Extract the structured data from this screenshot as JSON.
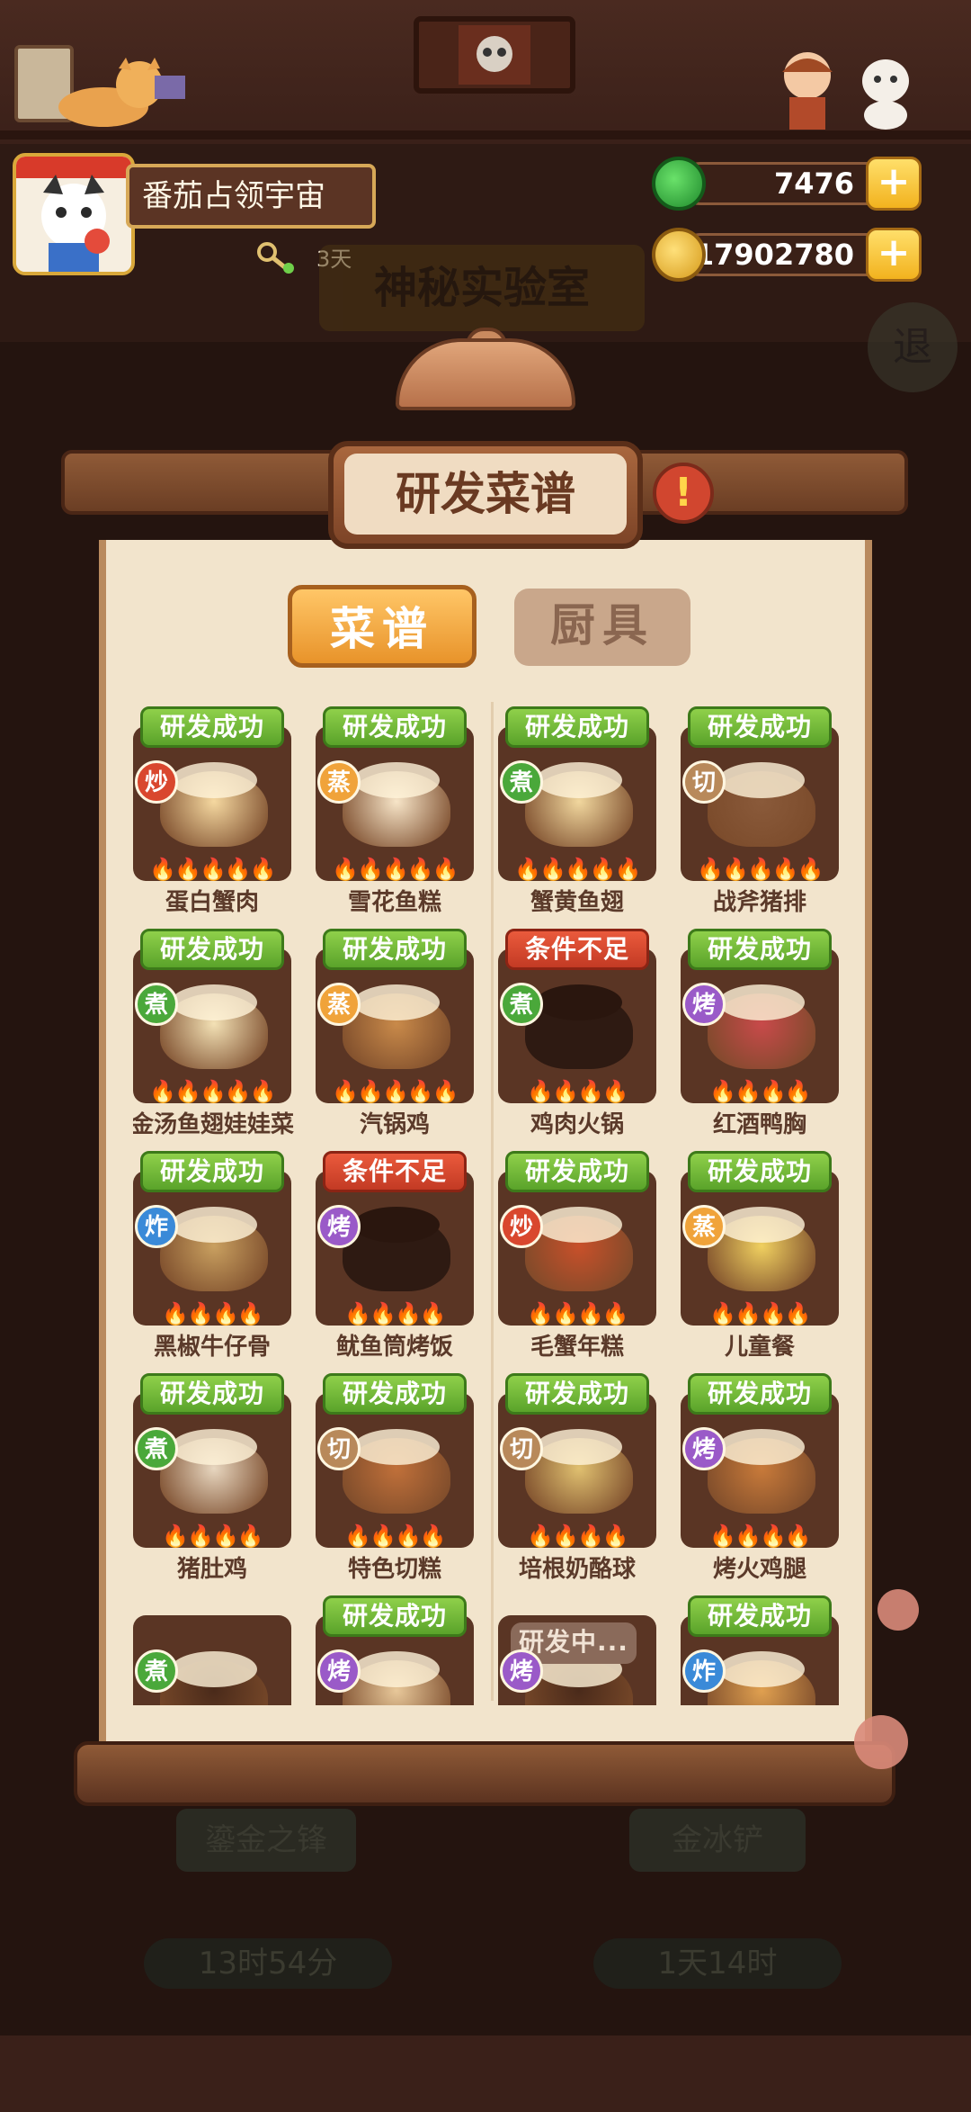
{
  "player": {
    "name": "番茄占领宇宙",
    "days": "3天"
  },
  "currency": {
    "jade": "7476",
    "coins": "17902780",
    "plus_label": "+"
  },
  "background": {
    "room_title": "神秘实验室",
    "exit_label": "退",
    "tool1": "鎏金之锋",
    "tool2": "金冰铲",
    "timer1": "13时54分",
    "timer2": "1天14时"
  },
  "panel": {
    "title": "研发菜谱",
    "alert": "!"
  },
  "tabs": {
    "recipes": "菜谱",
    "tools": "厨具"
  },
  "colors": {
    "success": "#6fbf35",
    "fail": "#d9472e",
    "accent": "#f0a33a"
  },
  "recipes": [
    {
      "status": "研发成功",
      "method": "炒",
      "name": "蛋白蟹肉",
      "flames": "🔥🔥🔥🔥🔥"
    },
    {
      "status": "研发成功",
      "method": "蒸",
      "name": "雪花鱼糕",
      "flames": "🔥🔥🔥🔥🔥"
    },
    {
      "status": "研发成功",
      "method": "煮",
      "name": "蟹黄鱼翅",
      "flames": "🔥🔥🔥🔥🔥"
    },
    {
      "status": "研发成功",
      "method": "切",
      "name": "战斧猪排",
      "flames": "🔥🔥🔥🔥🔥"
    },
    {
      "status": "研发成功",
      "method": "煮",
      "name": "金汤鱼翅娃娃菜",
      "flames": "🔥🔥🔥🔥🔥"
    },
    {
      "status": "研发成功",
      "method": "蒸",
      "name": "汽锅鸡",
      "flames": "🔥🔥🔥🔥🔥"
    },
    {
      "status": "条件不足",
      "method": "煮",
      "name": "鸡肉火锅",
      "flames": "🔥🔥🔥🔥"
    },
    {
      "status": "研发成功",
      "method": "烤",
      "name": "红酒鸭胸",
      "flames": "🔥🔥🔥🔥"
    },
    {
      "status": "研发成功",
      "method": "炸",
      "name": "黑椒牛仔骨",
      "flames": "🔥🔥🔥🔥"
    },
    {
      "status": "条件不足",
      "method": "烤",
      "name": "鱿鱼筒烤饭",
      "flames": "🔥🔥🔥🔥"
    },
    {
      "status": "研发成功",
      "method": "炒",
      "name": "毛蟹年糕",
      "flames": "🔥🔥🔥🔥"
    },
    {
      "status": "研发成功",
      "method": "蒸",
      "name": "儿童餐",
      "flames": "🔥🔥🔥🔥"
    },
    {
      "status": "研发成功",
      "method": "煮",
      "name": "猪肚鸡",
      "flames": "🔥🔥🔥🔥"
    },
    {
      "status": "研发成功",
      "method": "切",
      "name": "特色切糕",
      "flames": "🔥🔥🔥🔥"
    },
    {
      "status": "研发成功",
      "method": "切",
      "name": "培根奶酪球",
      "flames": "🔥🔥🔥🔥"
    },
    {
      "status": "研发成功",
      "method": "烤",
      "name": "烤火鸡腿",
      "flames": "🔥🔥🔥🔥"
    },
    {
      "status": "",
      "method": "煮",
      "name": "",
      "flames": ""
    },
    {
      "status": "研发成功",
      "method": "烤",
      "name": "",
      "flames": ""
    },
    {
      "status": "研发中...",
      "method": "烤",
      "name": "",
      "flames": ""
    },
    {
      "status": "研发成功",
      "method": "炸",
      "name": "",
      "flames": ""
    }
  ]
}
